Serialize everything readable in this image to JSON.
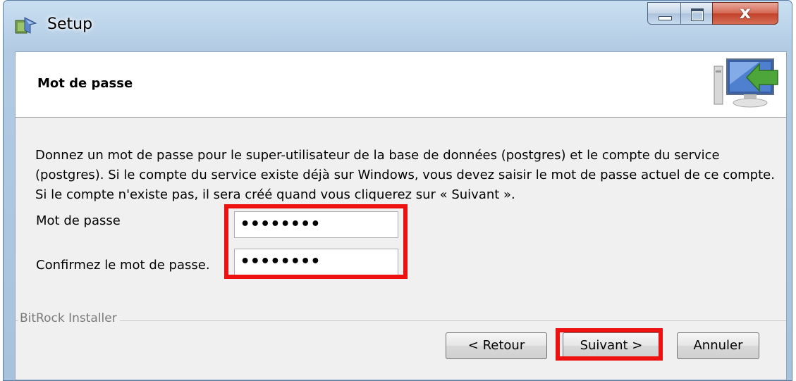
{
  "window": {
    "title": "Setup",
    "controls": {
      "minimize": "minimize-icon",
      "maximize": "maximize-icon",
      "close": "close-icon"
    }
  },
  "header": {
    "title": "Mot de passe",
    "icon": "computer-arrow-icon"
  },
  "body": {
    "description": "Donnez un mot de passe pour le super-utilisateur de la base de données (postgres) et le compte du service (postgres). Si le compte du service existe déjà sur Windows, vous devez saisir le mot de passe actuel de ce compte. Si le compte n'existe pas, il sera créé quand vous cliquerez sur « Suivant ».",
    "password_label": "Mot de passe",
    "password_value": "••••••••",
    "confirm_label": "Confirmez le mot de passe.",
    "confirm_value": "••••••••"
  },
  "footer": {
    "installer_label": "BitRock Installer",
    "back_label": "< Retour",
    "next_label": "Suivant >",
    "cancel_label": "Annuler"
  },
  "colors": {
    "highlight": "#ee1111",
    "titlebar": "#b9d1ea",
    "close_button": "#c9452f"
  }
}
